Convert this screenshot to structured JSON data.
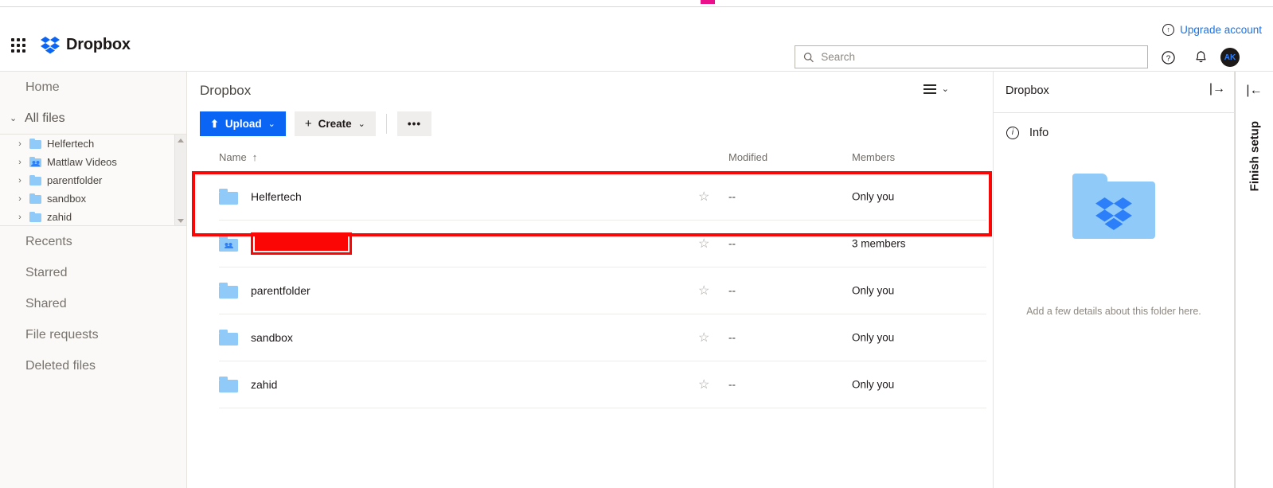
{
  "header": {
    "app_name": "Dropbox",
    "grid_icon": "app-grid-icon",
    "upgrade_label": "Upgrade account",
    "upgrade_icon": "upload-circle-icon",
    "help_icon": "help-circle-icon",
    "bell_icon": "notification-bell-icon",
    "avatar_initials": "AK"
  },
  "search": {
    "placeholder": "Search",
    "value": "",
    "icon": "search-icon"
  },
  "sidebar": {
    "home_label": "Home",
    "all_files_label": "All files",
    "all_files_caret": "⌄",
    "tree": [
      {
        "label": "Helfertech",
        "icon": "folder-icon",
        "shared": false,
        "chevron": "›"
      },
      {
        "label": "Mattlaw Videos",
        "icon": "shared-folder-icon",
        "shared": true,
        "chevron": "›"
      },
      {
        "label": "parentfolder",
        "icon": "folder-icon",
        "shared": false,
        "chevron": "›"
      },
      {
        "label": "sandbox",
        "icon": "folder-icon",
        "shared": false,
        "chevron": "›"
      },
      {
        "label": "zahid",
        "icon": "folder-icon",
        "shared": false,
        "chevron": "›"
      }
    ],
    "items": [
      {
        "label": "Recents"
      },
      {
        "label": "Starred"
      },
      {
        "label": "Shared"
      },
      {
        "label": "File requests"
      },
      {
        "label": "Deleted files"
      }
    ]
  },
  "main": {
    "title": "Dropbox",
    "view_toggle_icon": "list-view-icon",
    "view_toggle_caret": "⌄",
    "toolbar": {
      "upload_label": "Upload",
      "upload_icon": "upload-icon",
      "upload_caret": "⌄",
      "create_label": "Create",
      "create_icon": "plus-icon",
      "create_caret": "⌄",
      "more_label": "•••"
    },
    "columns": {
      "name": "Name",
      "name_sort": "↑",
      "modified": "Modified",
      "members": "Members"
    },
    "rows": [
      {
        "name": "Helfertech",
        "icon": "folder-icon",
        "shared": false,
        "redacted": false,
        "star": "☆",
        "modified": "--",
        "members": "Only you",
        "highlighted": true
      },
      {
        "name": "",
        "icon": "shared-folder-icon",
        "shared": true,
        "redacted": true,
        "star": "☆",
        "modified": "--",
        "members": "3 members",
        "highlighted": false
      },
      {
        "name": "parentfolder",
        "icon": "folder-icon",
        "shared": false,
        "redacted": false,
        "star": "☆",
        "modified": "--",
        "members": "Only you",
        "highlighted": false
      },
      {
        "name": "sandbox",
        "icon": "folder-icon",
        "shared": false,
        "redacted": false,
        "star": "☆",
        "modified": "--",
        "members": "Only you",
        "highlighted": false
      },
      {
        "name": "zahid",
        "icon": "folder-icon",
        "shared": false,
        "redacted": false,
        "star": "☆",
        "modified": "--",
        "members": "Only you",
        "highlighted": false
      }
    ]
  },
  "right_panel": {
    "title": "Dropbox",
    "collapse_icon": "|→",
    "info_label": "Info",
    "info_icon": "info-circle-icon",
    "preview_icon": "dropbox-folder-icon",
    "hint": "Add a few details about this folder here."
  },
  "rail": {
    "label": "Finish setup",
    "expand_icon": "|←"
  },
  "colors": {
    "accent_blue": "#0a65f5",
    "link_blue": "#1a73e8",
    "folder_blue": "#8fcaf9",
    "dropbox_logo_blue": "#2d7ff9",
    "annotation_red": "#fb0505",
    "sidebar_bg": "#faf9f7"
  }
}
